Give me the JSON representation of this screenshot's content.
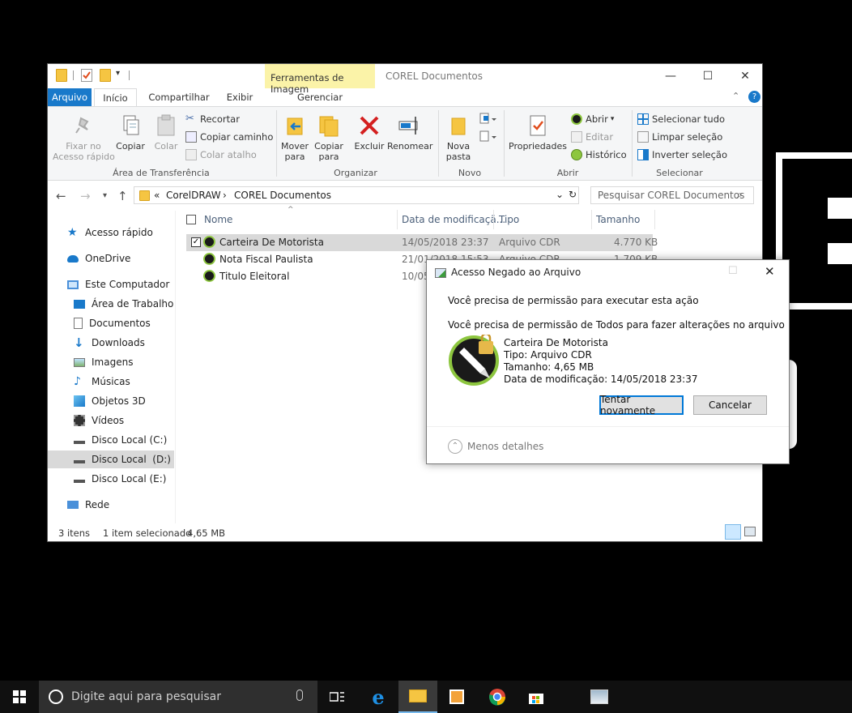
{
  "window": {
    "title": "COREL Documentos",
    "context_tab": "Ferramentas de Imagem",
    "tabs": [
      "Arquivo",
      "Início",
      "Compartilhar",
      "Exibir"
    ],
    "context_subtab": "Gerenciar"
  },
  "ribbon": {
    "clipboard": {
      "pin": "Fixar no\nAcesso rápido",
      "copy": "Copiar",
      "paste": "Colar",
      "cut": "Recortar",
      "copy_path": "Copiar caminho",
      "paste_shortcut": "Colar atalho",
      "label": "Área de Transferência"
    },
    "organize": {
      "move_to": "Mover\npara",
      "copy_to": "Copiar\npara",
      "delete": "Excluir",
      "rename": "Renomear",
      "label": "Organizar"
    },
    "new": {
      "new_folder": "Nova\npasta",
      "label": "Novo"
    },
    "open": {
      "properties": "Propriedades",
      "open": "Abrir",
      "edit": "Editar",
      "history": "Histórico",
      "label": "Abrir"
    },
    "select": {
      "select_all": "Selecionar tudo",
      "select_none": "Limpar seleção",
      "invert": "Inverter seleção",
      "label": "Selecionar"
    }
  },
  "address": {
    "prefix": "«",
    "path": [
      "CorelDRAW",
      "COREL Documentos"
    ],
    "search_placeholder": "Pesquisar COREL Documentos"
  },
  "nav": {
    "quick_access": "Acesso rápido",
    "onedrive": "OneDrive",
    "this_pc": "Este Computador",
    "desktop": "Área de Trabalho",
    "documents": "Documentos",
    "downloads": "Downloads",
    "pictures": "Imagens",
    "music": "Músicas",
    "objects3d": "Objetos 3D",
    "videos": "Vídeos",
    "disk_c": "Disco Local (C:)",
    "disk_d": "Disco Local  (D:)",
    "disk_e": "Disco Local (E:)",
    "network": "Rede"
  },
  "columns": {
    "name": "Nome",
    "modified": "Data de modificaçã...",
    "type": "Tipo",
    "size": "Tamanho"
  },
  "files": [
    {
      "name": "Carteira De Motorista",
      "modified": "14/05/2018 23:37",
      "type": "Arquivo CDR",
      "size": "4.770 KB"
    },
    {
      "name": "Nota Fiscal Paulista",
      "modified": "21/01/2018 15:53",
      "type": "Arquivo CDR",
      "size": "1.709 KB"
    },
    {
      "name": "Titulo Eleitoral",
      "modified": "10/05/2018 11:21",
      "type": "",
      "size": ""
    }
  ],
  "status": {
    "count": "3 itens",
    "selection": "1 item selecionado",
    "size": "4,65 MB"
  },
  "dialog": {
    "title": "Acesso Negado ao Arquivo",
    "line1": "Você precisa de permissão para executar esta ação",
    "line2": "Você precisa de permissão de Todos para fazer alterações no arquivo",
    "file_name": "Carteira De Motorista",
    "file_type": "Tipo: Arquivo CDR",
    "file_size": "Tamanho: 4,65 MB",
    "file_date": "Data de modificação: 14/05/2018 23:37",
    "retry": "Tentar novamente",
    "cancel": "Cancelar",
    "less_details": "Menos detalhes"
  },
  "taskbar": {
    "search_placeholder": "Digite aqui para pesquisar"
  },
  "colors": {
    "accent": "#1979ca",
    "context_tab": "#fbf3a8",
    "selection": "#cce8ff"
  }
}
